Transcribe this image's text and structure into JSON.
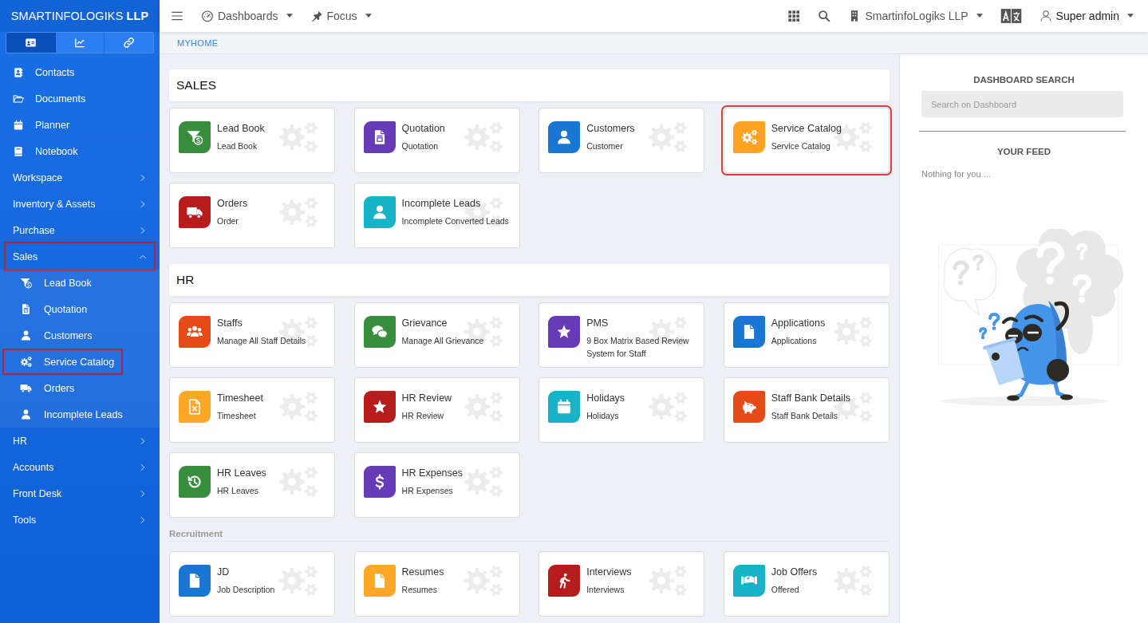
{
  "sidebar": {
    "brand": "SMARTINFOLOGIKS **LLP**",
    "tabs": [
      {
        "selected": true
      },
      {
        "selected": false
      },
      {
        "selected": false
      }
    ],
    "items": [
      {
        "kind": "link",
        "label": "Contacts",
        "highlighted": false
      },
      {
        "kind": "link",
        "label": "Documents",
        "highlighted": false
      },
      {
        "kind": "link",
        "label": "Planner",
        "highlighted": false
      },
      {
        "kind": "link",
        "label": "Notebook",
        "highlighted": false
      },
      {
        "kind": "menu",
        "label": "Workspace",
        "expanded": false,
        "highlighted": false
      },
      {
        "kind": "menu",
        "label": "Inventory & Assets",
        "expanded": false,
        "highlighted": false
      },
      {
        "kind": "menu",
        "label": "Purchase",
        "expanded": false,
        "highlighted": false
      },
      {
        "kind": "menu",
        "label": "Sales",
        "expanded": true,
        "highlighted": true,
        "children": [
          {
            "label": "Lead Book",
            "highlighted": false
          },
          {
            "label": "Quotation",
            "highlighted": false
          },
          {
            "label": "Customers",
            "highlighted": false
          },
          {
            "label": "Service Catalog",
            "highlighted": true
          },
          {
            "label": "Orders",
            "highlighted": false
          },
          {
            "label": "Incomplete Leads",
            "highlighted": false
          }
        ]
      },
      {
        "kind": "menu",
        "label": "HR",
        "expanded": false,
        "highlighted": false
      },
      {
        "kind": "menu",
        "label": "Accounts",
        "expanded": false,
        "highlighted": false
      },
      {
        "kind": "menu",
        "label": "Front Desk",
        "expanded": false,
        "highlighted": false
      },
      {
        "kind": "menu",
        "label": "Tools",
        "expanded": false,
        "highlighted": false
      }
    ]
  },
  "topbar": {
    "dashboards_menu": "Dashboards",
    "focus_menu": "Focus",
    "company_menu": "SmartinfoLogiks LLP",
    "user_menu": "Super admin"
  },
  "breadcrumb": "MYHOME",
  "sections": [
    {
      "kind": "panel",
      "title": "SALES",
      "cards": [
        {
          "title": "Lead Book",
          "subtitle": "Lead Book",
          "color": "#388e3c",
          "highlighted": false
        },
        {
          "title": "Quotation",
          "subtitle": "Quotation",
          "color": "#673ab7",
          "highlighted": false
        },
        {
          "title": "Customers",
          "subtitle": "Customer",
          "color": "#1976d2",
          "highlighted": false
        },
        {
          "title": "Service Catalog",
          "subtitle": "Service Catalog",
          "color": "#ffa21f",
          "highlighted": true
        },
        {
          "title": "Orders",
          "subtitle": "Order",
          "color": "#b71c1c",
          "highlighted": false
        },
        {
          "title": "Incomplete Leads",
          "subtitle": "Incomplete Converted Leads",
          "color": "#17b3c7",
          "highlighted": false
        }
      ]
    },
    {
      "kind": "panel",
      "title": "HR",
      "cards": [
        {
          "title": "Staffs",
          "subtitle": "Manage All Staff Details",
          "color": "#e64a19",
          "highlighted": false
        },
        {
          "title": "Grievance",
          "subtitle": "Manage All Grievance",
          "color": "#388e3c",
          "highlighted": false
        },
        {
          "title": "PMS",
          "subtitle": "9 Box Matrix Based Review System for Staff",
          "color": "#673ab7",
          "highlighted": false
        },
        {
          "title": "Applications",
          "subtitle": "Applications",
          "color": "#1976d2",
          "highlighted": false
        },
        {
          "title": "Timesheet",
          "subtitle": "Timesheet",
          "color": "#ffa726",
          "highlighted": false
        },
        {
          "title": "HR Review",
          "subtitle": "HR Review",
          "color": "#b71c1c",
          "highlighted": false
        },
        {
          "title": "Holidays",
          "subtitle": "Holidays",
          "color": "#17b3c7",
          "highlighted": false
        },
        {
          "title": "Staff Bank Details",
          "subtitle": "Staff Bank Details",
          "color": "#e64a19",
          "highlighted": false
        },
        {
          "title": "HR Leaves",
          "subtitle": "HR Leaves",
          "color": "#388e3c",
          "highlighted": false
        },
        {
          "title": "HR Expenses",
          "subtitle": "HR Expenses",
          "color": "#673ab7",
          "highlighted": false
        }
      ]
    },
    {
      "kind": "subhead",
      "title": "Recruitment",
      "cards": [
        {
          "title": "JD",
          "subtitle": "Job Description",
          "color": "#1976d2",
          "highlighted": false
        },
        {
          "title": "Resumes",
          "subtitle": "Resumes",
          "color": "#ffa726",
          "highlighted": false
        },
        {
          "title": "Interviews",
          "subtitle": "Interviews",
          "color": "#b71c1c",
          "highlighted": false
        },
        {
          "title": "Job Offers",
          "subtitle": "Offered",
          "color": "#17b3c7",
          "highlighted": false
        }
      ]
    }
  ],
  "right_panel": {
    "search_title": "DASHBOARD SEARCH",
    "search": {
      "placeholder": "Search on Dashboard"
    },
    "feed_title": "YOUR FEED",
    "feed_empty": "Nothing for you ..."
  }
}
